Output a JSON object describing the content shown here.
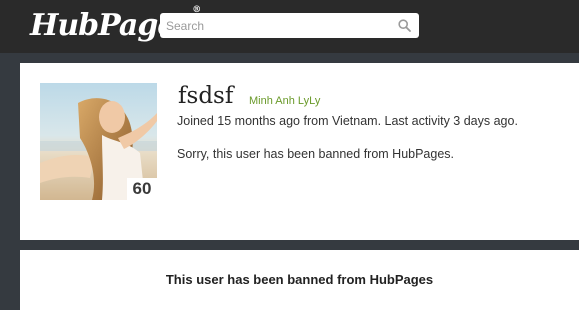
{
  "header": {
    "logo_text": "HubPages",
    "logo_mark": "®",
    "search_placeholder": "Search",
    "search_icon": "search-icon"
  },
  "profile": {
    "username": "fsdsf",
    "real_name": "Minh Anh LyLy",
    "joined_text": "Joined 15 months ago from Vietnam. Last activity 3 days ago.",
    "banned_message": "Sorry, this user has been banned from HubPages.",
    "hubber_score": "60"
  },
  "main": {
    "banned_heading": "This user has been banned from HubPages"
  },
  "colors": {
    "header_bg": "#2a2a2a",
    "page_bg": "#353a40",
    "panel_bg": "#ffffff",
    "name_link": "#6a9a2a"
  }
}
